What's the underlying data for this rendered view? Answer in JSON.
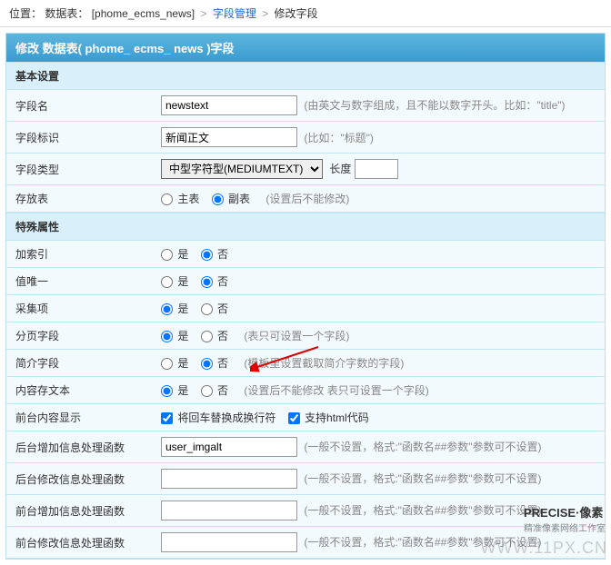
{
  "breadcrumb": {
    "prefix": "位置：",
    "table_prefix": "数据表：",
    "table_name": "[phome_ecms_news]",
    "link1": "字段管理",
    "current": "修改字段"
  },
  "panel": {
    "title": "修改 数据表( phome_ ecms_ news )字段"
  },
  "section1": "基本设置",
  "section2": "特殊属性",
  "fields": {
    "name_label": "字段名",
    "name_value": "newstext",
    "name_hint": "(由英文与数字组成，且不能以数字开头。比如：\"title\")",
    "sign_label": "字段标识",
    "sign_value": "新闻正文",
    "sign_hint": "(比如：\"标题\")",
    "type_label": "字段类型",
    "type_value": "中型字符型(MEDIUMTEXT)",
    "length_label": "长度",
    "length_value": "",
    "store_label": "存放表",
    "store_main": "主表",
    "store_sub": "副表",
    "store_hint": "(设置后不能修改)",
    "index_label": "加索引",
    "unique_label": "值唯一",
    "collect_label": "采集项",
    "page_label": "分页字段",
    "page_hint": "(表只可设置一个字段)",
    "brief_label": "简介字段",
    "brief_hint": "(模板里设置截取简介字数的字段)",
    "bigtext_label": "内容存文本",
    "bigtext_hint": "(设置后不能修改 表只可设置一个字段)",
    "fdisplay_label": "前台内容显示",
    "fdisplay_br": "将回车替换成换行符",
    "fdisplay_html": "支持html代码",
    "badd_label": "后台增加信息处理函数",
    "badd_value": "user_imgalt",
    "func_hint": "(一般不设置，格式:\"函数名##参数\"参数可不设置)",
    "bedit_label": "后台修改信息处理函数",
    "fadd_label": "前台增加信息处理函数",
    "fedit_label": "前台修改信息处理函数",
    "yes": "是",
    "no": "否"
  },
  "watermark": {
    "url": "WWW.11PX.CN",
    "brand": "PRECISE·像素",
    "sub": "精准像素网络工作室"
  }
}
